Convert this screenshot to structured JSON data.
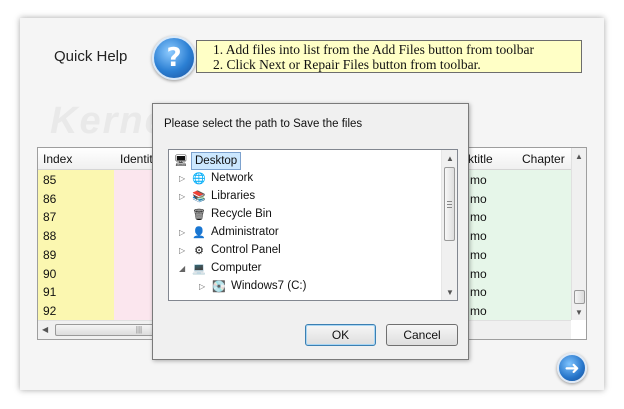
{
  "quick_help": {
    "label": "Quick Help",
    "line1": "1. Add files into list from the Add Files button from toolbar",
    "line2": "2. Click Next or Repair Files button from toolbar."
  },
  "watermark": "Kernel",
  "grid": {
    "headers": {
      "index": "Index",
      "identity": "Identit",
      "tasktitle": "ktitle",
      "chapter": "Chapter"
    },
    "rows": [
      {
        "index": "85",
        "task": "mo"
      },
      {
        "index": "86",
        "task": "mo"
      },
      {
        "index": "87",
        "task": "mo"
      },
      {
        "index": "88",
        "task": "mo"
      },
      {
        "index": "89",
        "task": "mo"
      },
      {
        "index": "90",
        "task": "mo"
      },
      {
        "index": "91",
        "task": "mo"
      },
      {
        "index": "92",
        "task": "mo"
      }
    ]
  },
  "dialog": {
    "title": "Please select the path to Save the files",
    "tree": [
      {
        "label": "Desktop",
        "icon": "desktop-icon"
      },
      {
        "label": "Network",
        "icon": "network-icon"
      },
      {
        "label": "Libraries",
        "icon": "libraries-icon"
      },
      {
        "label": "Recycle Bin",
        "icon": "recycle-bin-icon"
      },
      {
        "label": "Administrator",
        "icon": "user-folder-icon"
      },
      {
        "label": "Control Panel",
        "icon": "control-panel-icon"
      },
      {
        "label": "Computer",
        "icon": "computer-icon"
      },
      {
        "label": "Windows7  (C:)",
        "icon": "drive-icon"
      }
    ],
    "ok_label": "OK",
    "cancel_label": "Cancel"
  },
  "colors": {
    "help_box_bg": "#ffffc6",
    "index_col_bg": "#fbf7b0",
    "identity_col_bg": "#fbe6ee",
    "green_col_bg": "#e6f6e9",
    "selection_bg": "#cce8ff"
  }
}
